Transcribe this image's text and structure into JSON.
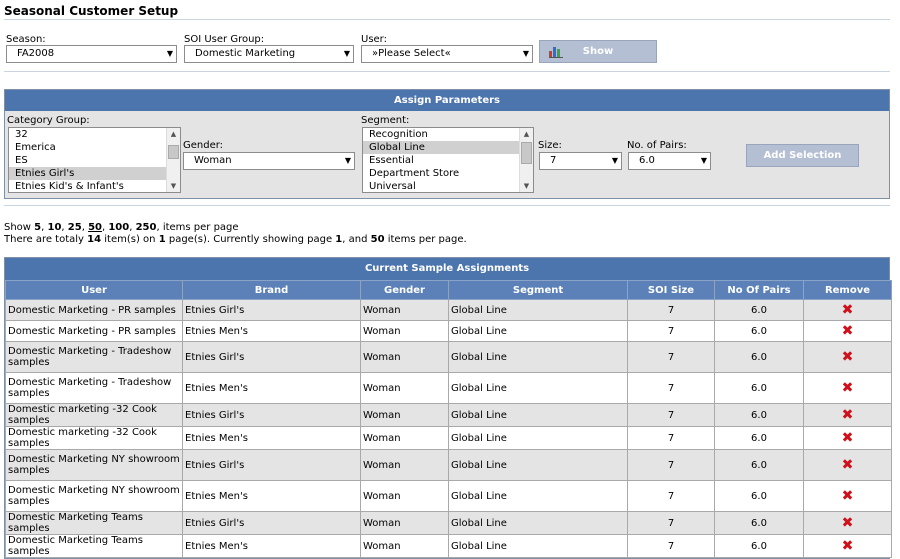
{
  "page_title": "Seasonal Customer Setup",
  "filters": {
    "season_label": "Season:",
    "season_value": "FA2008",
    "soi_group_label": "SOI User Group:",
    "soi_group_value": "Domestic Marketing",
    "user_label": "User:",
    "user_value": "»Please Select«",
    "show_label": "Show"
  },
  "assign": {
    "title": "Assign Parameters",
    "category_label": "Category Group:",
    "categories": [
      {
        "label": "32",
        "selected": false
      },
      {
        "label": "Emerica",
        "selected": false
      },
      {
        "label": "ES",
        "selected": false
      },
      {
        "label": "Etnies Girl's",
        "selected": true
      },
      {
        "label": "Etnies Kid's & Infant's",
        "selected": false
      }
    ],
    "gender_label": "Gender:",
    "gender_value": "Woman",
    "segment_label": "Segment:",
    "segments": [
      {
        "label": "Recognition",
        "selected": false
      },
      {
        "label": "Global Line",
        "selected": true
      },
      {
        "label": "Essential",
        "selected": false
      },
      {
        "label": "Department Store",
        "selected": false
      },
      {
        "label": "Universal",
        "selected": false
      }
    ],
    "size_label": "Size:",
    "size_value": "7",
    "pairs_label": "No. of Pairs:",
    "pairs_value": "6.0",
    "add_label": "Add Selection"
  },
  "paging": {
    "show_prefix": "Show",
    "sizes": [
      "5",
      "10",
      "25",
      "50",
      "100",
      "250"
    ],
    "show_suffix": "items per page",
    "summary_1": "There are totaly",
    "total_items": "14",
    "summary_2": "item(s) on",
    "total_pages": "1",
    "summary_3": "page(s). Currently showing page",
    "current_page": "1",
    "summary_4": ", and",
    "per_page": "50",
    "summary_5": "items per page."
  },
  "grid": {
    "title": "Current Sample Assignments",
    "columns": [
      "User",
      "Brand",
      "Gender",
      "Segment",
      "SOI Size",
      "No Of Pairs",
      "Remove"
    ],
    "rows": [
      [
        "Domestic Marketing - PR samples",
        "Etnies Girl's",
        "Woman",
        "Global Line",
        "7",
        "6.0"
      ],
      [
        "Domestic Marketing - PR samples",
        "Etnies Men's",
        "Woman",
        "Global Line",
        "7",
        "6.0"
      ],
      [
        "Domestic Marketing - Tradeshow samples",
        "Etnies Girl's",
        "Woman",
        "Global Line",
        "7",
        "6.0"
      ],
      [
        "Domestic Marketing - Tradeshow samples",
        "Etnies Men's",
        "Woman",
        "Global Line",
        "7",
        "6.0"
      ],
      [
        "Domestic marketing -32 Cook samples",
        "Etnies Girl's",
        "Woman",
        "Global Line",
        "7",
        "6.0"
      ],
      [
        "Domestic marketing -32 Cook samples",
        "Etnies Men's",
        "Woman",
        "Global Line",
        "7",
        "6.0"
      ],
      [
        "Domestic Marketing NY showroom samples",
        "Etnies Girl's",
        "Woman",
        "Global Line",
        "7",
        "6.0"
      ],
      [
        "Domestic Marketing NY showroom samples",
        "Etnies Men's",
        "Woman",
        "Global Line",
        "7",
        "6.0"
      ],
      [
        "Domestic Marketing Teams samples",
        "Etnies Girl's",
        "Woman",
        "Global Line",
        "7",
        "6.0"
      ],
      [
        "Domestic Marketing Teams samples",
        "Etnies Men's",
        "Woman",
        "Global Line",
        "7",
        "6.0"
      ]
    ],
    "remove_icon": "delete-x-icon",
    "remove_color": "#d0101a"
  }
}
